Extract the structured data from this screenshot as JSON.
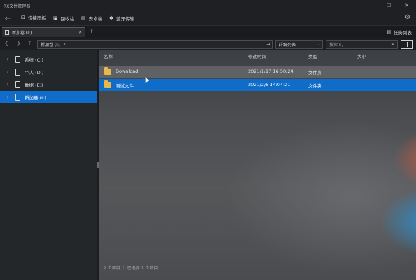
{
  "window": {
    "title": "RX文件管理器",
    "controls": [
      "—",
      "☐",
      "✕"
    ]
  },
  "toolbar": {
    "back_icon": "back-arrow-icon",
    "items": [
      {
        "label": "快捷面板",
        "icon": "dashboard-icon"
      },
      {
        "label": "回收站",
        "icon": "recycle-bin-icon"
      },
      {
        "label": "安卓端",
        "icon": "android-icon"
      },
      {
        "label": "蓝牙传输",
        "icon": "bluetooth-icon"
      }
    ],
    "settings_icon": "gear-icon"
  },
  "tabs": [
    {
      "label": "新加卷 (I:)"
    }
  ],
  "task_list_label": "任务列表",
  "address_bar": {
    "path": "新加卷 (I:)",
    "chevron": "›"
  },
  "sort_select": {
    "value": "详细列表"
  },
  "search": {
    "placeholder": "搜索 I:\\"
  },
  "sidebar": {
    "items": [
      {
        "label": "系统 (C:)",
        "selected": false
      },
      {
        "label": "个人 (D:)",
        "selected": false
      },
      {
        "label": "数据 (E:)",
        "selected": false
      },
      {
        "label": "新加卷 (I:)",
        "selected": true
      }
    ]
  },
  "file_list": {
    "columns": [
      "名称",
      "修改时间",
      "类型",
      "大小"
    ],
    "rows": [
      {
        "name": "Download",
        "modified": "2021/1/17 16:50:24",
        "type": "文件夹",
        "size": "",
        "state": "hover"
      },
      {
        "name": "测试文件",
        "modified": "2021/2/6 14:04:21",
        "type": "文件夹",
        "size": "",
        "state": "selected"
      }
    ]
  },
  "status": {
    "item_count": "2 个项目",
    "selected_count": "已选择 1 个项目"
  },
  "colors": {
    "accent": "#0f6cc8",
    "folder": "#e8b84a"
  }
}
